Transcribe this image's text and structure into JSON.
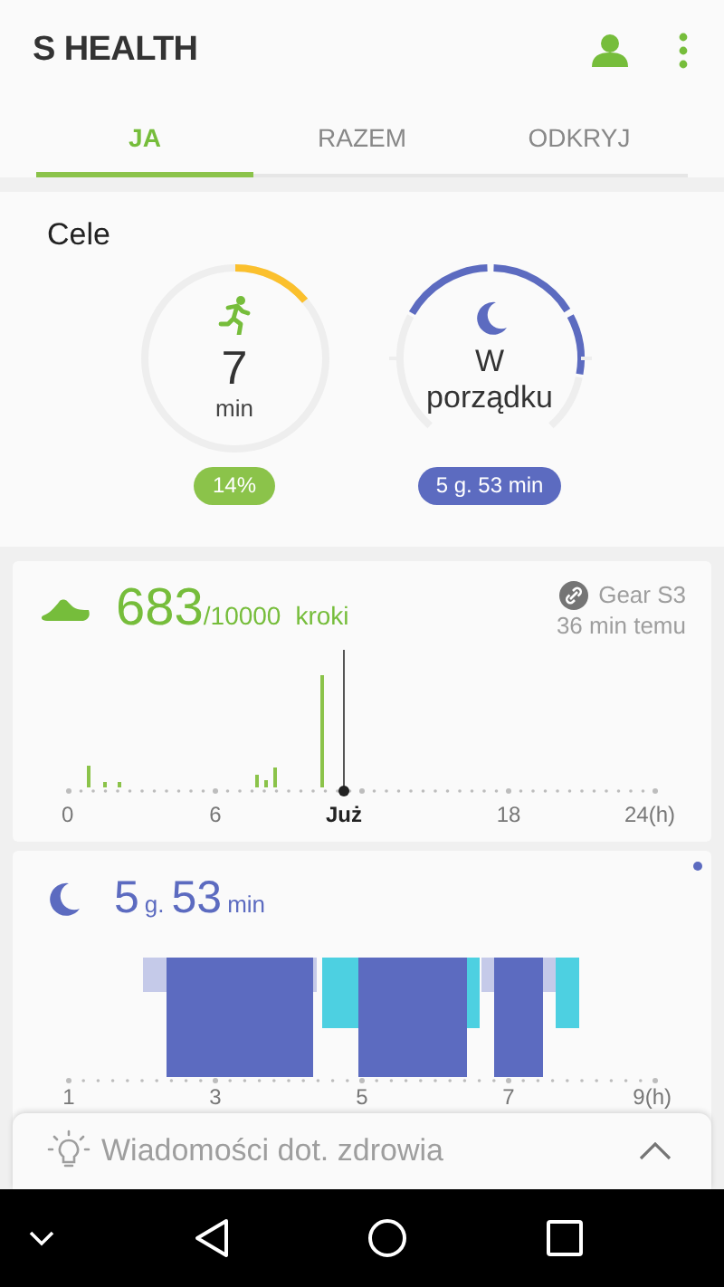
{
  "app": {
    "title": "S HEALTH"
  },
  "tabs": [
    {
      "label": "JA",
      "selected": true
    },
    {
      "label": "RAZEM",
      "selected": false
    },
    {
      "label": "ODKRYJ",
      "selected": false
    }
  ],
  "goals": {
    "title": "Cele",
    "items": [
      {
        "kind": "activity",
        "value": "7",
        "unit": "min",
        "badge": "14%"
      },
      {
        "kind": "sleep",
        "status": "W porządku",
        "badge": "5 g. 53 min"
      }
    ]
  },
  "steps": {
    "count": "683",
    "goal": "/10000",
    "unit": "kroki",
    "device": "Gear S3",
    "synced": "36 min temu",
    "axis_labels": [
      "0",
      "6",
      "Już",
      "18",
      "24(h)"
    ]
  },
  "sleep": {
    "hours": "5",
    "hours_unit": "g.",
    "minutes": "53",
    "minutes_unit": "min",
    "axis_labels": [
      "1",
      "3",
      "5",
      "7",
      "9(h)"
    ]
  },
  "news": {
    "title": "Wiadomości dot. zdrowia"
  }
}
